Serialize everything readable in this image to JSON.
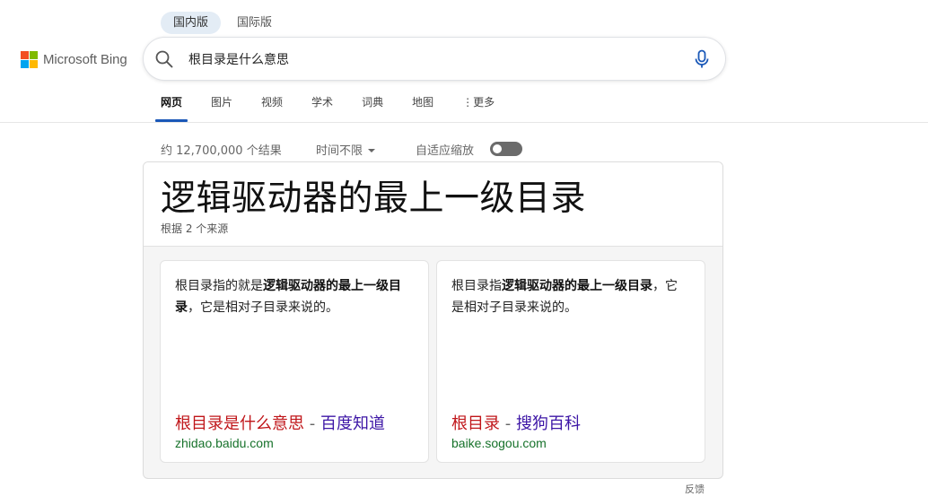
{
  "region_tabs": [
    {
      "label": "国内版",
      "active": true
    },
    {
      "label": "国际版",
      "active": false
    }
  ],
  "logo": {
    "text": "Microsoft Bing",
    "colors": [
      "#f25022",
      "#7fba00",
      "#00a4ef",
      "#ffb900"
    ]
  },
  "search": {
    "value": "根目录是什么意思",
    "placeholder": ""
  },
  "nav": {
    "items": [
      "网页",
      "图片",
      "视频",
      "学术",
      "词典",
      "地图"
    ],
    "more_label": "更多",
    "active_index": 0,
    "accent": "#1a58b8"
  },
  "results": {
    "count_text": "约 12,700,000 个结果",
    "time_filter": "时间不限",
    "adaptive_label": "自适应缩放",
    "adaptive_on": false
  },
  "answer": {
    "title": "逻辑驱动器的最上一级目录",
    "subtitle": "根据 2 个来源",
    "sources": [
      {
        "snippet_pre": "根目录指的就是",
        "snippet_bold": "逻辑驱动器的最上一级目录",
        "snippet_post": "，它是相对子目录来说的。",
        "title_main": "根目录是什么意思",
        "title_sep": " - ",
        "title_site": "百度知道",
        "url": "zhidao.baidu.com"
      },
      {
        "snippet_pre": "根目录指",
        "snippet_bold": "逻辑驱动器的最上一级目录",
        "snippet_post": "，它是相对子目录来说的。",
        "title_main": "根目录",
        "title_sep": " - ",
        "title_site": "搜狗百科",
        "url": "baike.sogou.com"
      }
    ]
  },
  "feedback_label": "反馈"
}
